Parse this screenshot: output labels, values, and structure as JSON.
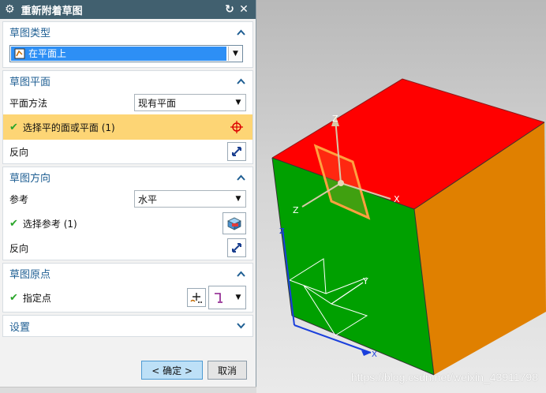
{
  "dialog": {
    "title": "重新附着草图",
    "icons": {
      "settings": "gear-icon",
      "reset": "reset-icon",
      "close": "close-icon"
    }
  },
  "sections": {
    "sketch_type": {
      "header": "草图类型",
      "selected": "在平面上"
    },
    "sketch_plane": {
      "header": "草图平面",
      "method_label": "平面方法",
      "method_value": "现有平面",
      "select_label": "选择平的面或平面 (1)",
      "reverse_label": "反向"
    },
    "sketch_orientation": {
      "header": "草图方向",
      "reference_label": "参考",
      "reference_value": "水平",
      "select_label": "选择参考 (1)",
      "reverse_label": "反向"
    },
    "sketch_origin": {
      "header": "草图原点",
      "point_label": "指定点"
    },
    "settings": {
      "header": "设置"
    }
  },
  "buttons": {
    "ok": "< 确定 >",
    "cancel": "取消"
  },
  "viewport": {
    "axis_labels": {
      "x": "X",
      "y": "Y",
      "z": "Z"
    },
    "watermark": "https://blog.csdn.net/weixin_43911798"
  },
  "colors": {
    "titlebar": "#41606f",
    "section_header": "#1f5f93",
    "highlight": "#fdd575",
    "cube_top": "#ff0000",
    "cube_front": "#00a000",
    "cube_right": "#e08000",
    "plane_outline": "#ffa040"
  }
}
